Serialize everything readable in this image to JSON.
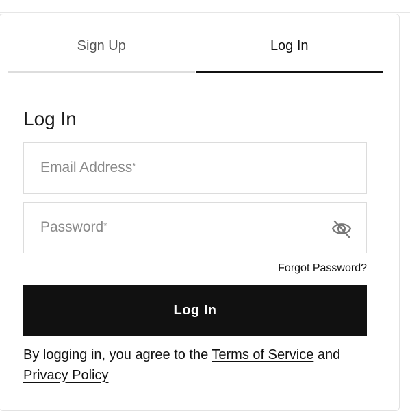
{
  "tabs": {
    "signup_label": "Sign Up",
    "login_label": "Log In",
    "active": "login"
  },
  "form": {
    "heading": "Log In",
    "email": {
      "placeholder": "Email Address",
      "required_mark": "*",
      "value": ""
    },
    "password": {
      "placeholder": "Password",
      "required_mark": "*",
      "value": "",
      "toggle_icon": "eye-off-icon"
    },
    "forgot_label": "Forgot Password?",
    "submit_label": "Log In"
  },
  "legal": {
    "prefix": "By logging in, you agree to the ",
    "terms_label": "Terms of Service",
    "middle": " and",
    "privacy_label": "Privacy Policy"
  },
  "colors": {
    "button_bg": "#111111",
    "active_tab_border": "#111111",
    "inactive_tab_border": "#dddddd",
    "placeholder_text": "#8a8a8a"
  }
}
